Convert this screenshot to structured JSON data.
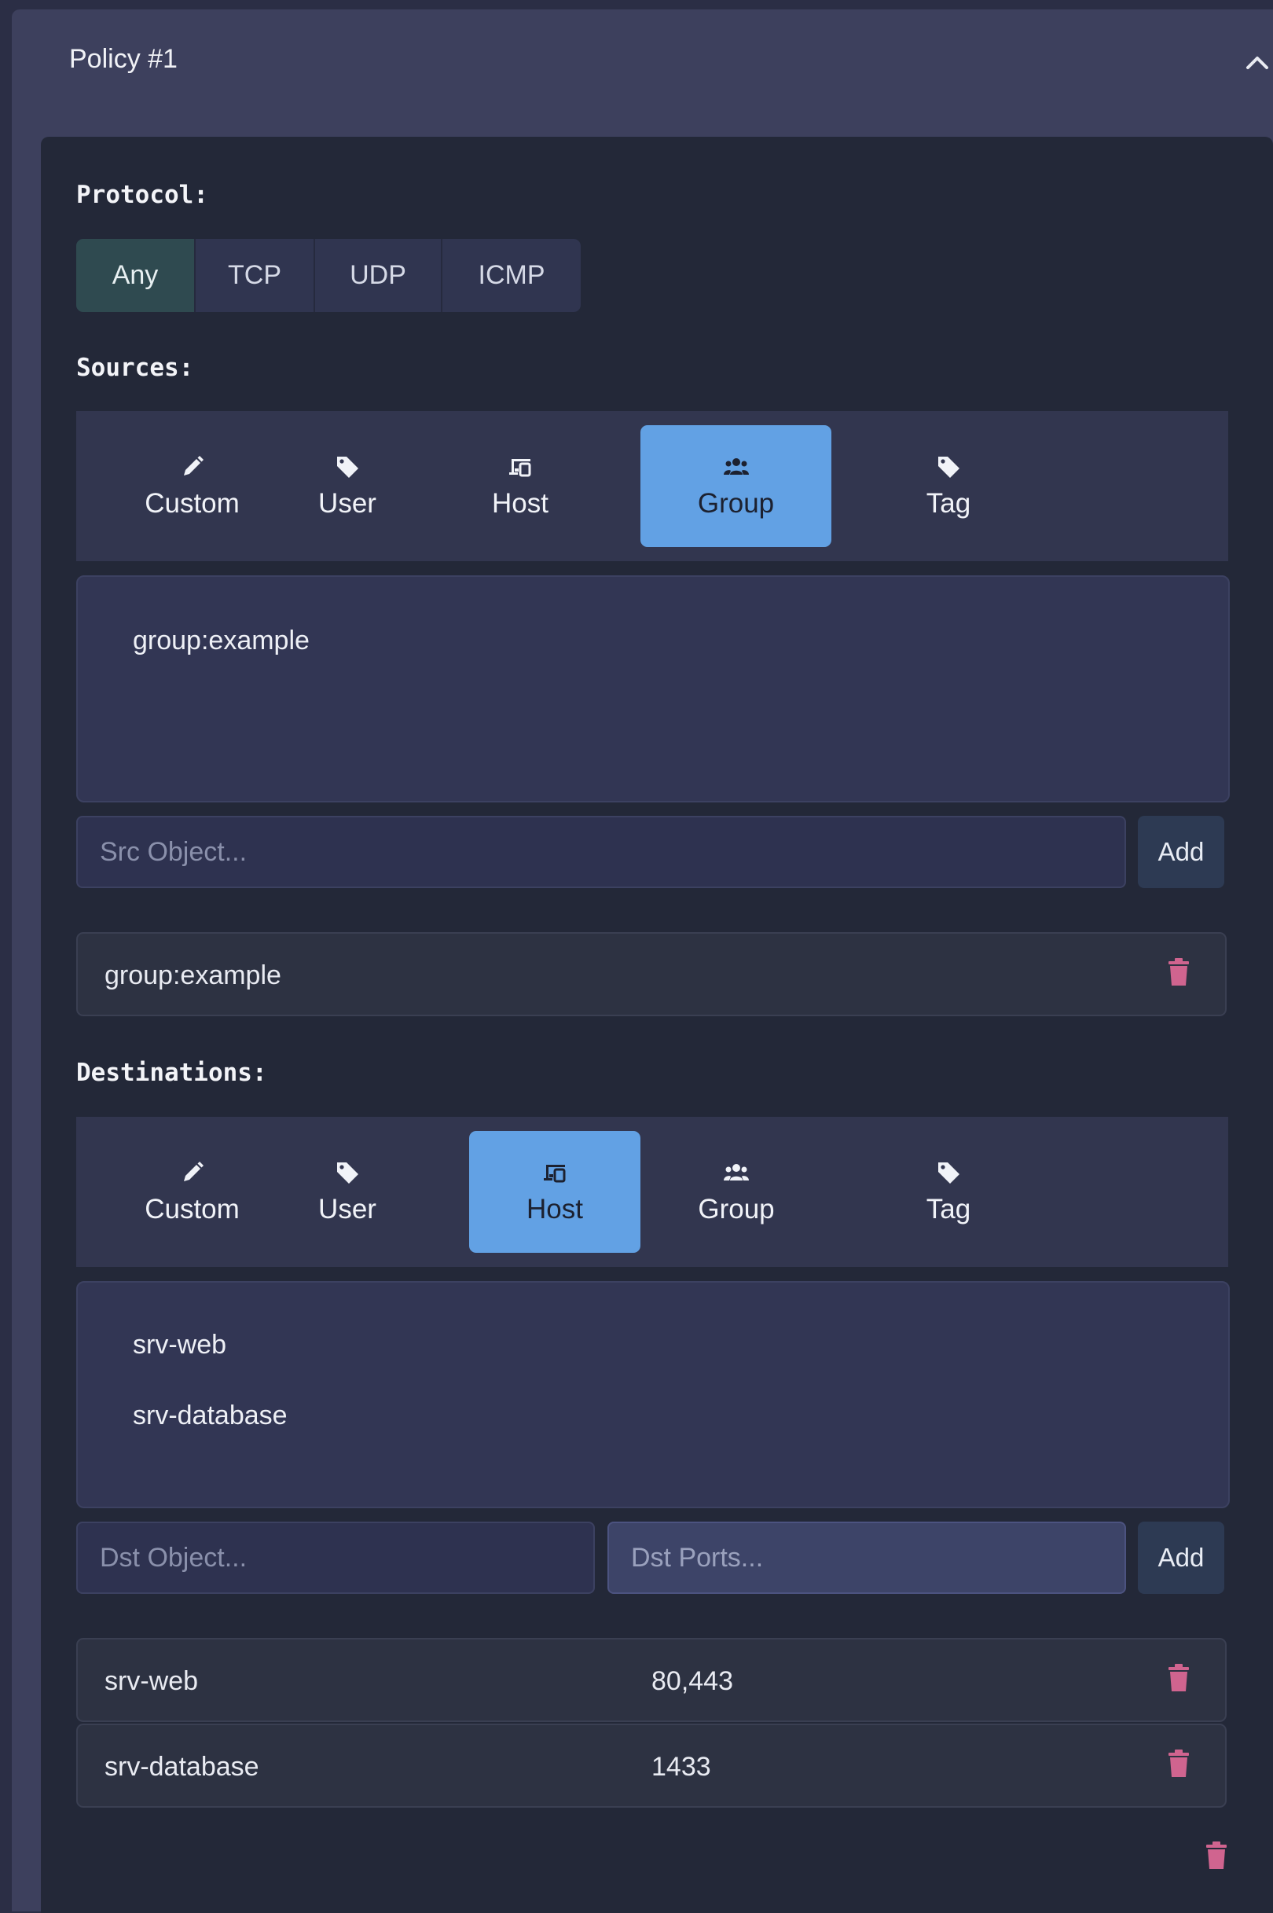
{
  "policy": {
    "title": "Policy #1"
  },
  "protocol": {
    "label": "Protocol:",
    "options": [
      "Any",
      "TCP",
      "UDP",
      "ICMP"
    ],
    "selected": "Any"
  },
  "sources": {
    "label": "Sources:",
    "tabs": [
      "Custom",
      "User",
      "Host",
      "Group",
      "Tag"
    ],
    "active_tab": "Group",
    "available": [
      "group:example"
    ],
    "input_placeholder": "Src Object...",
    "add_label": "Add",
    "selected": [
      {
        "name": "group:example"
      }
    ]
  },
  "destinations": {
    "label": "Destinations:",
    "tabs": [
      "Custom",
      "User",
      "Host",
      "Group",
      "Tag"
    ],
    "active_tab": "Host",
    "available": [
      "srv-web",
      "srv-database"
    ],
    "object_placeholder": "Dst Object...",
    "ports_placeholder": "Dst Ports...",
    "add_label": "Add",
    "selected": [
      {
        "name": "srv-web",
        "ports": "80,443"
      },
      {
        "name": "srv-database",
        "ports": "1433"
      }
    ]
  },
  "colors": {
    "accent": "#62a1e4",
    "danger": "#d0648f",
    "protocol_active": "#2f4a50"
  },
  "icons": {
    "Custom": "pencil-icon",
    "User": "tag-icon",
    "Host": "devices-icon",
    "Group": "users-icon",
    "Tag": "tag-icon"
  }
}
